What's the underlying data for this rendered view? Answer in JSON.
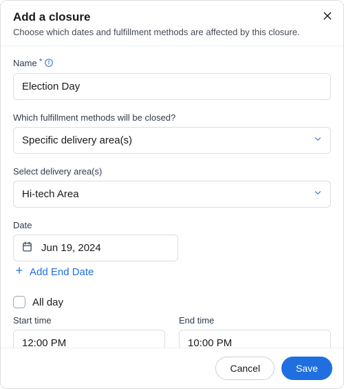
{
  "header": {
    "title": "Add a closure",
    "subtitle": "Choose which dates and fulfillment methods are affected by this closure."
  },
  "fields": {
    "name": {
      "label": "Name",
      "value": "Election Day"
    },
    "fulfillment": {
      "label": "Which fulfillment methods will be closed?",
      "value": "Specific delivery area(s)"
    },
    "area": {
      "label": "Select delivery area(s)",
      "value": "Hi-tech Area"
    },
    "date": {
      "label": "Date",
      "value": "Jun 19, 2024"
    },
    "addEnd": "Add End Date",
    "allDay": {
      "label": "All day",
      "checked": false
    },
    "startTime": {
      "label": "Start time",
      "value": "12:00 PM"
    },
    "endTime": {
      "label": "End time",
      "value": "10:00 PM"
    }
  },
  "footer": {
    "cancel": "Cancel",
    "save": "Save"
  }
}
